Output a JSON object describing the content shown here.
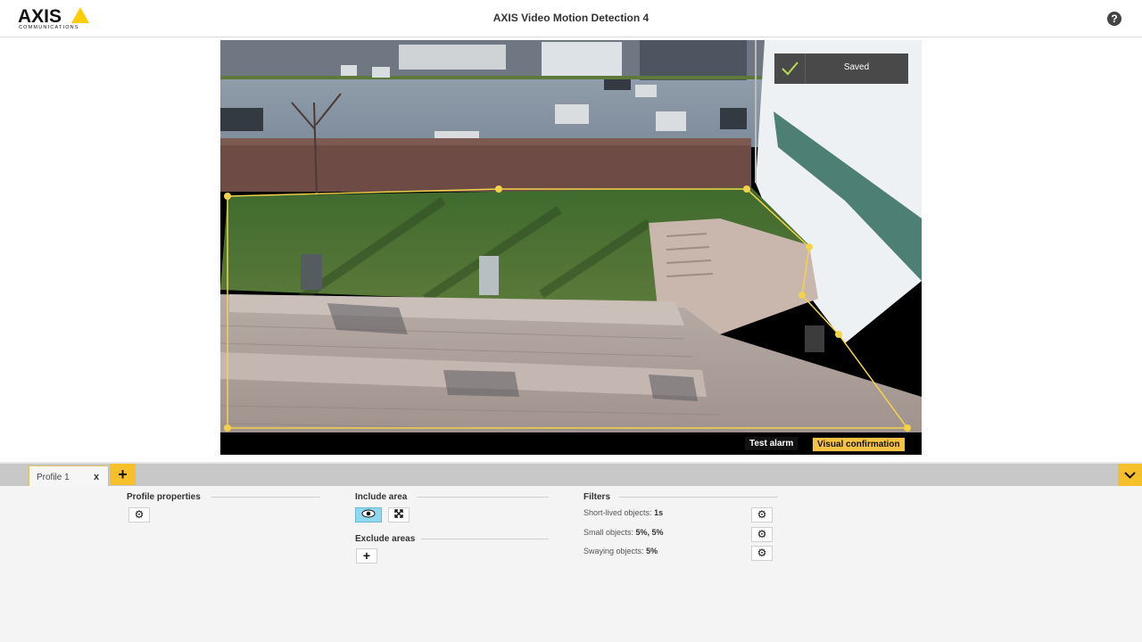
{
  "header": {
    "logo_text": "AXIS",
    "logo_subtext": "COMMUNICATIONS",
    "title": "AXIS Video Motion Detection 4",
    "help_icon": "?"
  },
  "video": {
    "status": "Saved",
    "test_alarm_label": "Test alarm",
    "visual_confirmation_label": "Visual confirmation"
  },
  "profiles": {
    "tabs": [
      {
        "label": "Profile 1",
        "close": "x"
      }
    ],
    "add_icon": "+"
  },
  "panels": {
    "profile_properties": {
      "title": "Profile properties"
    },
    "include_area": {
      "title": "Include area"
    },
    "exclude_areas": {
      "title": "Exclude areas"
    },
    "filters": {
      "title": "Filters",
      "items": [
        {
          "label": "Short-lived objects:",
          "value": "1s"
        },
        {
          "label": "Small objects:",
          "value": "5%, 5%"
        },
        {
          "label": "Swaying objects:",
          "value": "5%"
        }
      ]
    }
  },
  "colors": {
    "accent": "#f6c02b",
    "active_toggle": "#8fd8f0",
    "polygon": "#f3d34a"
  }
}
